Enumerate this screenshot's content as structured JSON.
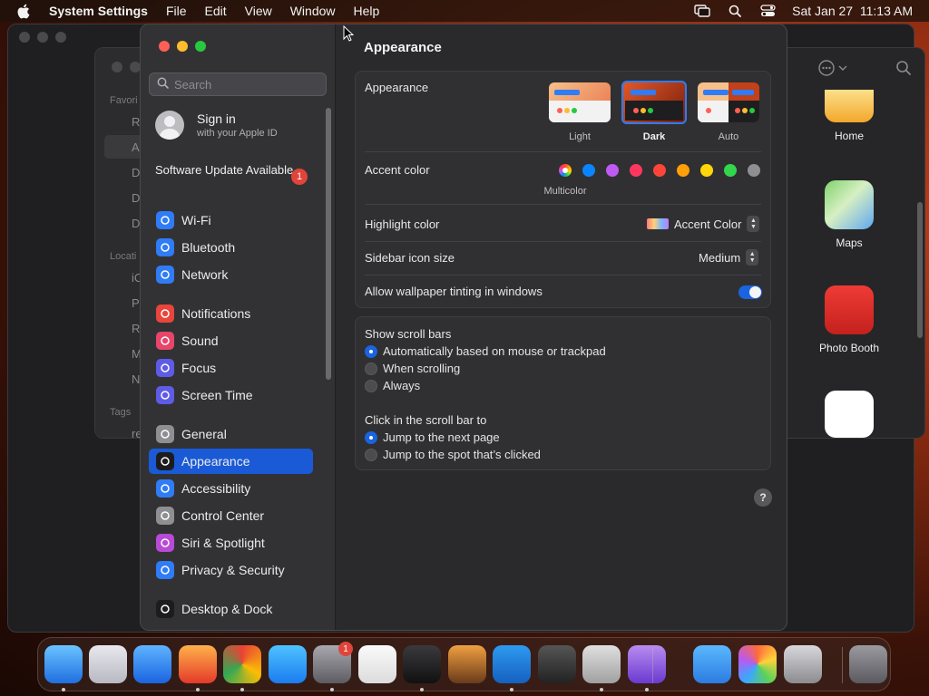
{
  "menubar": {
    "app_name": "System Settings",
    "items": [
      "File",
      "Edit",
      "View",
      "Window",
      "Help"
    ],
    "clock": "Sat Jan 27  11:13 AM"
  },
  "background_finder": {
    "sidebar_labels": [
      "Favori",
      "Locati",
      "Tags"
    ],
    "sidebar_items": [
      "R",
      "A",
      "D",
      "D",
      "D",
      "iC",
      "P",
      "R",
      "M",
      "N",
      "re"
    ],
    "apps": [
      "Home",
      "Maps",
      "Photo Booth"
    ]
  },
  "sidebar": {
    "search_placeholder": "Search",
    "profile": {
      "title": "Sign in",
      "subtitle": "with your Apple ID"
    },
    "update": {
      "label": "Software Update Available",
      "badge": "1"
    },
    "items": [
      {
        "label": "Wi-Fi",
        "icon": "wifi-icon",
        "color": "#2f7cf6"
      },
      {
        "label": "Bluetooth",
        "icon": "bluetooth-icon",
        "color": "#2f7cf6"
      },
      {
        "label": "Network",
        "icon": "globe-icon",
        "color": "#2f7cf6"
      },
      {
        "label": "Notifications",
        "icon": "bell-icon",
        "color": "#e8453c"
      },
      {
        "label": "Sound",
        "icon": "speaker-icon",
        "color": "#e8456a"
      },
      {
        "label": "Focus",
        "icon": "moon-icon",
        "color": "#5e5ce6"
      },
      {
        "label": "Screen Time",
        "icon": "hourglass-icon",
        "color": "#5e5ce6"
      },
      {
        "label": "General",
        "icon": "gear-icon",
        "color": "#8e8e93"
      },
      {
        "label": "Appearance",
        "icon": "appearance-icon",
        "color": "#1c1c1e"
      },
      {
        "label": "Accessibility",
        "icon": "accessibility-icon",
        "color": "#2f7cf6"
      },
      {
        "label": "Control Center",
        "icon": "control-center-icon",
        "color": "#8e8e93"
      },
      {
        "label": "Siri & Spotlight",
        "icon": "siri-icon",
        "color": "#b84ad6"
      },
      {
        "label": "Privacy & Security",
        "icon": "hand-icon",
        "color": "#2f7cf6"
      },
      {
        "label": "Desktop & Dock",
        "icon": "dock-icon",
        "color": "#1c1c1e"
      }
    ],
    "active_index": 8
  },
  "main": {
    "title": "Appearance",
    "appearance": {
      "label": "Appearance",
      "options": [
        "Light",
        "Dark",
        "Auto"
      ],
      "selected": "Dark"
    },
    "accent": {
      "label": "Accent color",
      "caption": "Multicolor",
      "colors": [
        "#0a84ff",
        "#bf5af2",
        "#ff375f",
        "#ff453a",
        "#ff9f0a",
        "#ffd60a",
        "#32d74b",
        "#8e8e93"
      ]
    },
    "highlight": {
      "label": "Highlight color",
      "value": "Accent Color"
    },
    "sidebar_icon_size": {
      "label": "Sidebar icon size",
      "value": "Medium"
    },
    "wallpaper_tinting": {
      "label": "Allow wallpaper tinting in windows",
      "on": true
    },
    "scroll_bars": {
      "label": "Show scroll bars",
      "options": [
        "Automatically based on mouse or trackpad",
        "When scrolling",
        "Always"
      ],
      "selected_index": 0
    },
    "click_scroll": {
      "label": "Click in the scroll bar to",
      "options": [
        "Jump to the next page",
        "Jump to the spot that’s clicked"
      ],
      "selected_index": 0
    },
    "help": "?"
  },
  "dock": {
    "apps": [
      "Finder",
      "Launchpad",
      "Safari",
      "Firefox",
      "Chrome",
      "App Store",
      "System Settings",
      "TextEdit",
      "Terminal",
      "Instruments",
      "VS Code",
      "Bartender",
      "Roblox",
      "Visual Studio",
      "Weather",
      "Photos",
      "Image Capture",
      "Trash"
    ],
    "settings_badge": "1"
  }
}
